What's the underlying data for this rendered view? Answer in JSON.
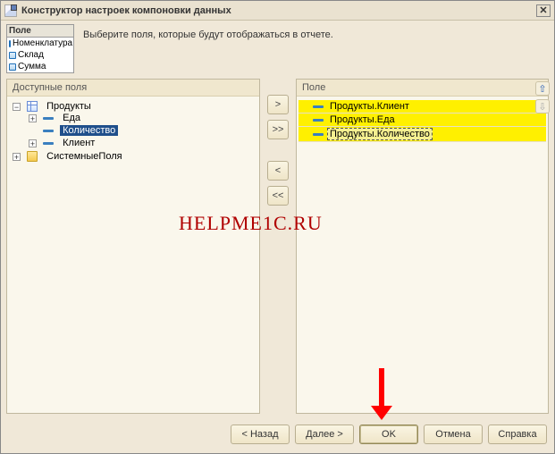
{
  "title": "Конструктор настроек компоновки данных",
  "intro": "Выберите поля, которые будут отображаться в отчете.",
  "fields_box": {
    "header": "Поле",
    "rows": [
      "Номенклатура",
      "Склад",
      "Сумма"
    ]
  },
  "left_panel": {
    "header": "Доступные поля"
  },
  "right_panel": {
    "header": "Поле"
  },
  "tree": {
    "root1": "Продукты",
    "child_eda": "Еда",
    "child_kol": "Количество",
    "child_kli": "Клиент",
    "root2": "СистемныеПоля"
  },
  "selected_rows": [
    {
      "label": "Продукты.Клиент"
    },
    {
      "label": "Продукты.Еда"
    },
    {
      "label": "Продукты.Количество"
    }
  ],
  "mid_buttons": {
    "add": ">",
    "add_all": ">>",
    "remove": "<",
    "remove_all": "<<"
  },
  "order_arrows": {
    "up": "⇧",
    "down": "⇩"
  },
  "footer": {
    "back": "< Назад",
    "next": "Далее >",
    "ok": "OK",
    "cancel": "Отмена",
    "help": "Справка"
  },
  "watermark": "HELPME1C.RU"
}
